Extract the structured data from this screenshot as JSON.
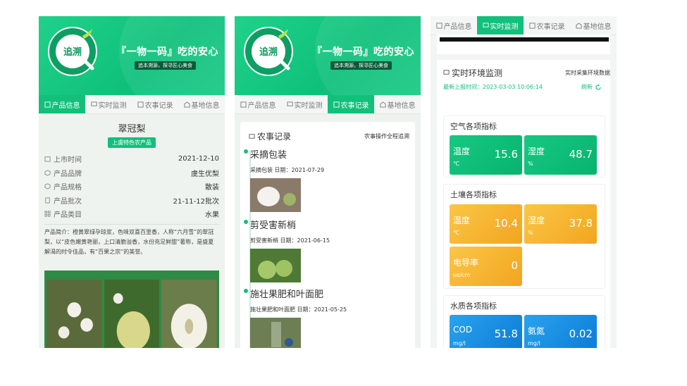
{
  "banner": {
    "seal_text": "追溯",
    "slogan": "『一物一码』吃的安心",
    "sub_slogan": "追本溯源，探寻匠心美食"
  },
  "tabs": [
    "产品信息",
    "实时监测",
    "农事记录",
    "基地信息"
  ],
  "product": {
    "name": "翠冠梨",
    "badge": "上虞特色农产品",
    "fields": [
      {
        "icon": "calendar-icon",
        "label": "上市时间",
        "value": "2021-12-10"
      },
      {
        "icon": "cube-icon",
        "label": "产品品牌",
        "value": "虞生优梨"
      },
      {
        "icon": "cube-icon",
        "label": "产品规格",
        "value": "散装"
      },
      {
        "icon": "document-icon",
        "label": "产品批次",
        "value": "21-11-12批次"
      },
      {
        "icon": "grid-icon",
        "label": "产品类目",
        "value": "水果"
      }
    ],
    "intro": "产品简介：橙黄翠绿孕琼浆，色味双喜百里香，人称“六月雪”的翠冠梨，以“皮色嫩黄艳丽，上口清脆溢香，水份充足鲜甜”著称，是盛夏解渴的时令佳品，有“百果之宗”的美誉。"
  },
  "records": {
    "title": "农事记录",
    "subtitle": "农事操作全程追溯",
    "items": [
      {
        "title": "采摘包装",
        "meta": "采摘包装 日期：2021-07-29"
      },
      {
        "title": "剪受害新梢",
        "meta": "剪受害新梢 日期：2021-06-15"
      },
      {
        "title": "施壮果肥和叶面肥",
        "meta": "施壮果肥和叶面肥 日期：2021-05-25"
      }
    ]
  },
  "monitor": {
    "title": "实时环境监测",
    "subtitle": "实时采集环境数据",
    "last_report": "最新上报时间：2023-03-03 10:06:14",
    "refresh": "刷新",
    "sections": [
      {
        "title": "空气各项指标",
        "tiles": [
          {
            "label": "温度",
            "unit": "℃",
            "value": "15.6",
            "color": "green"
          },
          {
            "label": "湿度",
            "unit": "%",
            "value": "48.7",
            "color": "green"
          }
        ]
      },
      {
        "title": "土壤各项指标",
        "tiles": [
          {
            "label": "温度",
            "unit": "℃",
            "value": "10.4",
            "color": "orange"
          },
          {
            "label": "湿度",
            "unit": "%",
            "value": "37.8",
            "color": "orange"
          },
          {
            "label": "电导率",
            "unit": "us/cm",
            "value": "0",
            "color": "orange"
          }
        ]
      },
      {
        "title": "水质各项指标",
        "tiles": [
          {
            "label": "COD",
            "unit": "mg/l",
            "value": "51.8",
            "color": "blue"
          },
          {
            "label": "氨氮",
            "unit": "mg/l",
            "value": "0.02",
            "color": "blue"
          }
        ]
      }
    ]
  },
  "colors": {
    "accent": "#12c07c",
    "orange": "#f5b12e",
    "blue": "#1a8fe3"
  }
}
